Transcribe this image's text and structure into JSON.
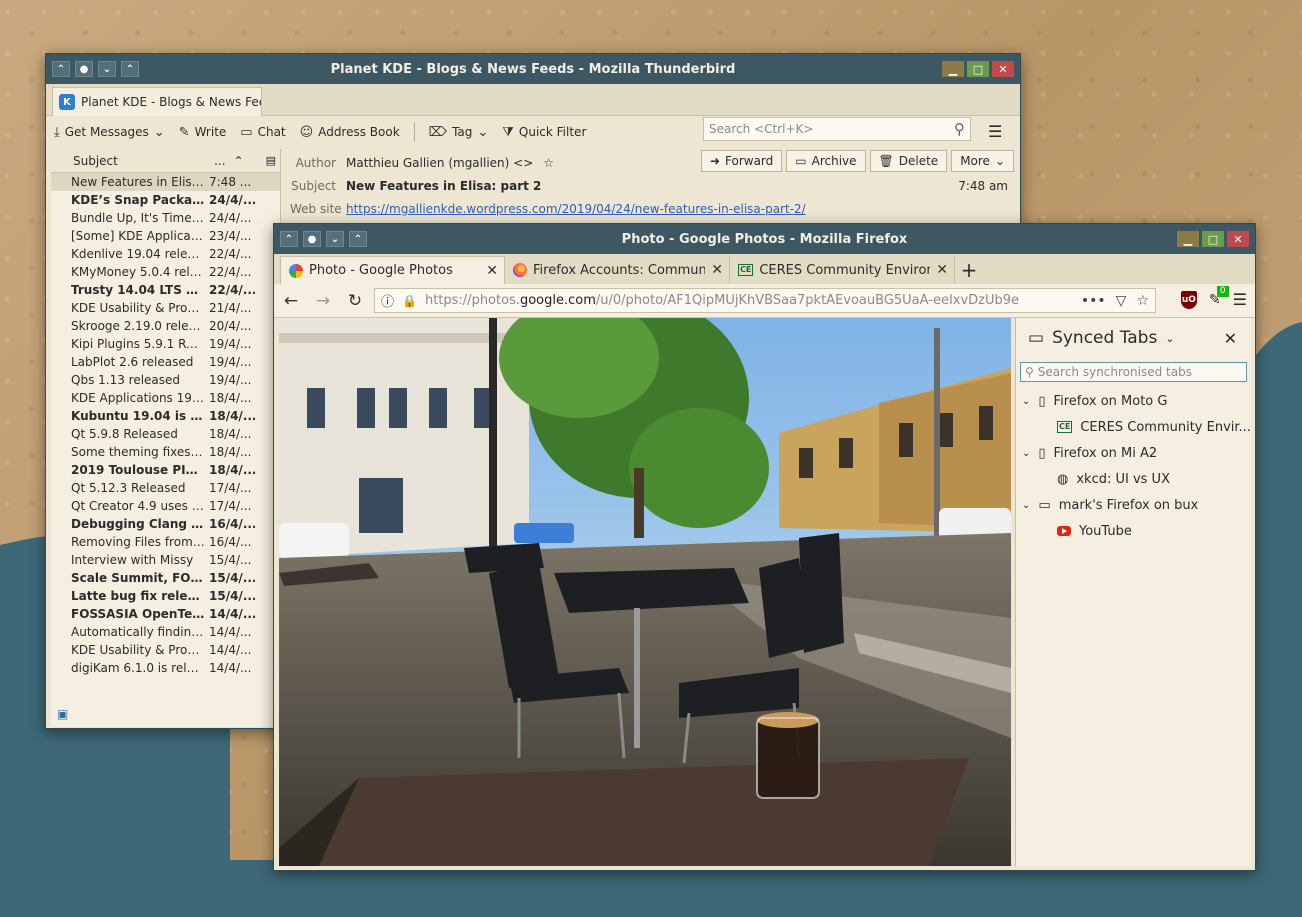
{
  "thunderbird": {
    "window_title": "Planet KDE - Blogs & News Feeds - Mozilla Thunderbird",
    "tab_label": "Planet KDE - Blogs & News Feeds",
    "toolbar": {
      "get_messages": "Get Messages",
      "write": "Write",
      "chat": "Chat",
      "address_book": "Address Book",
      "tag": "Tag",
      "quick_filter": "Quick Filter"
    },
    "search_placeholder": "Search <Ctrl+K>",
    "thread_header": {
      "subject": "Subject",
      "dots": "..."
    },
    "messages": [
      {
        "subject": "New Features in Elisa...",
        "date": "7:48 ...",
        "bold": false,
        "selected": true
      },
      {
        "subject": "KDE’s Snap Packages",
        "date": "24/4/...",
        "bold": true
      },
      {
        "subject": "Bundle Up, It's Time ...",
        "date": "24/4/...",
        "bold": false
      },
      {
        "subject": "[Some] KDE Applicati...",
        "date": "23/4/...",
        "bold": false
      },
      {
        "subject": "Kdenlive 19.04 releas...",
        "date": "22/4/...",
        "bold": false
      },
      {
        "subject": "KMyMoney 5.0.4 rele...",
        "date": "22/4/...",
        "bold": false
      },
      {
        "subject": "Trusty 14.04 LTS en...",
        "date": "22/4/...",
        "bold": true
      },
      {
        "subject": "KDE Usability & Prod...",
        "date": "21/4/...",
        "bold": false
      },
      {
        "subject": "Skrooge 2.19.0 relea...",
        "date": "20/4/...",
        "bold": false
      },
      {
        "subject": "Kipi Plugins 5.9.1 Rele...",
        "date": "19/4/...",
        "bold": false
      },
      {
        "subject": "LabPlot 2.6 released",
        "date": "19/4/...",
        "bold": false
      },
      {
        "subject": "Qbs 1.13 released",
        "date": "19/4/...",
        "bold": false
      },
      {
        "subject": "KDE Applications 19....",
        "date": "18/4/...",
        "bold": false
      },
      {
        "subject": "Kubuntu 19.04 is rel...",
        "date": "18/4/...",
        "bold": true
      },
      {
        "subject": "Qt 5.9.8 Released",
        "date": "18/4/...",
        "bold": false
      },
      {
        "subject": "Some theming fixes t...",
        "date": "18/4/...",
        "bold": false
      },
      {
        "subject": "2019 Toulouse PIM ...",
        "date": "18/4/...",
        "bold": true
      },
      {
        "subject": "Qt 5.12.3 Released",
        "date": "17/4/...",
        "bold": false
      },
      {
        "subject": "Qt Creator 4.9 uses K...",
        "date": "17/4/...",
        "bold": false
      },
      {
        "subject": "Debugging Clang A...",
        "date": "16/4/...",
        "bold": true
      },
      {
        "subject": "Removing Files from ...",
        "date": "16/4/...",
        "bold": false
      },
      {
        "subject": "Interview with Missy",
        "date": "15/4/...",
        "bold": false
      },
      {
        "subject": "Scale Summit, FOSS...",
        "date": "15/4/...",
        "bold": true
      },
      {
        "subject": "Latte bug fix releas...",
        "date": "15/4/...",
        "bold": true
      },
      {
        "subject": "FOSSASIA OpenTec...",
        "date": "14/4/...",
        "bold": true
      },
      {
        "subject": "Automatically finding ...",
        "date": "14/4/...",
        "bold": false
      },
      {
        "subject": "KDE Usability & Prod...",
        "date": "14/4/...",
        "bold": false
      },
      {
        "subject": "digiKam 6.1.0 is relea...",
        "date": "14/4/...",
        "bold": false
      }
    ],
    "header": {
      "author_label": "Author",
      "author": "Matthieu Gallien (mgallien) <>",
      "subject_label": "Subject",
      "subject": "New Features in Elisa: part 2",
      "website_label": "Web site",
      "website": "https://mgallienkde.wordpress.com/2019/04/24/new-features-in-elisa-part-2/",
      "time": "7:48 am",
      "buttons": {
        "forward": "Forward",
        "archive": "Archive",
        "delete": "Delete",
        "more": "More"
      }
    }
  },
  "firefox": {
    "window_title": "Photo - Google Photos - Mozilla Firefox",
    "tabs": [
      {
        "label": "Photo - Google Photos",
        "icon": "google-photos-icon"
      },
      {
        "label": "Firefox Accounts: Commun",
        "icon": "firefox-icon"
      },
      {
        "label": "CERES Community Environ",
        "icon": "ceres-icon"
      }
    ],
    "url": {
      "prefix": "https://photos.",
      "domain": "google.com",
      "path": "/u/0/photo/AF1QipMUjKhVBSaa7pktAEvoauBG5UaA-eeIxvDzUb9e"
    },
    "addon_badge": "0",
    "ublock_label": "uO",
    "sidebar": {
      "title": "Synced Tabs",
      "search_placeholder": "Search synchronised tabs",
      "devices": [
        {
          "name": "Firefox on Moto G",
          "device_icon": "phone-icon",
          "tabs": [
            {
              "label": "CERES Community Envir...",
              "icon": "ceres-icon"
            }
          ]
        },
        {
          "name": "Firefox on Mi A2",
          "device_icon": "phone-icon",
          "tabs": [
            {
              "label": "xkcd: UI vs UX",
              "icon": "globe-icon"
            }
          ]
        },
        {
          "name": "mark's Firefox on bux",
          "device_icon": "laptop-icon",
          "tabs": [
            {
              "label": "YouTube",
              "icon": "youtube-icon"
            }
          ]
        }
      ]
    }
  },
  "colors": {
    "titlebar": "#3d5862",
    "window_bg": "#ece6d2",
    "desktop_paper": "#c4a47c",
    "desktop_sea": "#3e6877",
    "link": "#2d5fb8"
  }
}
